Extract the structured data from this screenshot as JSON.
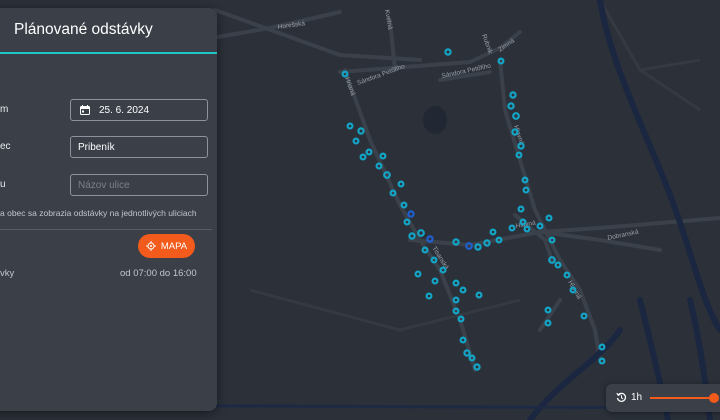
{
  "panel": {
    "title": "Plánované odstávky",
    "date_label": "m",
    "date_value": "25. 6. 2024",
    "municipality_label": "ec",
    "municipality_value": "Pribeník",
    "street_label": "u",
    "street_placeholder": "Názov ulice",
    "note": "a obec sa zobrazia odstávky na jednotlivých uliciach",
    "map_button_label": "MAPA",
    "result_label": "vky",
    "result_time": "od 07:00 do 16:00"
  },
  "map": {
    "streets": [
      "Horešská",
      "Kvetná",
      "Rubnik",
      "Zimná",
      "Sándora Petőfiho",
      "Sándora Petőfiho",
      "Hrianá",
      "Hlavná",
      "Hlavná",
      "Dobranská",
      "Tisanská",
      "Hlavná"
    ],
    "colors": {
      "background": "#2b3039",
      "road": "#3b414b",
      "river": "#1b2740",
      "outage_marker": "#13a4c6",
      "outage_marker_dark": "#1f5fd0"
    }
  },
  "time_control": {
    "label": "1h",
    "level": 1.0,
    "accent": "#f25b1c"
  }
}
